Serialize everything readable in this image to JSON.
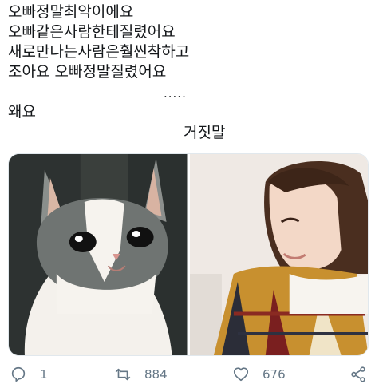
{
  "tweet": {
    "lines": [
      "오빠정말최악이에요",
      "오빠같은사람한테질렸어요",
      "새로만나는사람은훨씬착하고",
      "조아요 오빠정말질렸어요",
      ".....",
      "왜요",
      "거짓말"
    ]
  },
  "media": {
    "left_icon": "crying-cat-photo",
    "right_icon": "smiling-man-photo"
  },
  "actions": {
    "reply_icon": "reply-icon",
    "reply_count": "1",
    "retweet_icon": "retweet-icon",
    "retweet_count": "884",
    "like_icon": "heart-icon",
    "like_count": "676",
    "share_icon": "share-icon"
  },
  "colors": {
    "text": "#14171a",
    "action": "#657786",
    "border": "#e1e8ed"
  }
}
